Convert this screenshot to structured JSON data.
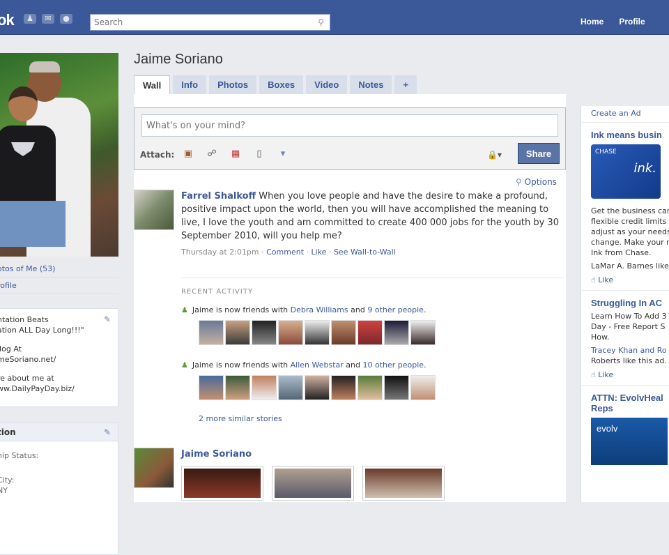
{
  "topbar": {
    "logo": "ok",
    "search_placeholder": "Search",
    "nav": [
      "Home",
      "Profile"
    ]
  },
  "left": {
    "photos_link": "otos of Me (53)",
    "profile_link": "rofile",
    "bio": [
      "ntation Beats\nation ALL Day Long!!!\"",
      "llog At\nmeSoriano.net/",
      "re about me at\nww.DailyPayDay.biz/"
    ],
    "info": {
      "header": "tion",
      "rows": [
        "hip Status:",
        "City:",
        "NY"
      ]
    }
  },
  "profile": {
    "name": "Jaime Soriano",
    "tabs": [
      "Wall",
      "Info",
      "Photos",
      "Boxes",
      "Video",
      "Notes",
      "+"
    ]
  },
  "composer": {
    "placeholder": "What's on your mind?",
    "attach_label": "Attach:",
    "share_label": "Share"
  },
  "options_label": "Options",
  "story1": {
    "actor": "Farrel Shalkoff",
    "text": " When you love people and have the desire to make a profound, positive impact upon the world, then you will have accomplished the meaning to live, I love the youth and am committed to create 400 000 jobs for the youth by 30 September 2010, will you help me?",
    "time": "Thursday at 2:01pm",
    "comment": "Comment",
    "like": "Like",
    "wall": "See Wall-to-Wall"
  },
  "recent": {
    "header": "RECENT ACTIVITY",
    "line1": {
      "prefix": "Jaime is now friends with ",
      "friend": "Debra Williams",
      "and": " and ",
      "others": "9 other people",
      "end": "."
    },
    "line2": {
      "prefix": "Jaime is now friends with ",
      "friend": "Allen Webstar",
      "and": " and ",
      "others": "10 other people",
      "end": "."
    },
    "more": "2 more similar stories"
  },
  "story2": {
    "actor": "Jaime Soriano"
  },
  "right": {
    "create_ad": "Create an Ad",
    "ad1": {
      "title": "Ink means busin",
      "body": [
        "Get the business car",
        "flexible credit limits t",
        "adjust as your needs",
        "change. Make your n",
        "Ink from Chase."
      ],
      "liker": "LaMar A. Barnes like",
      "like": "Like",
      "card_brand": "CHASE",
      "card_mark": "ink."
    },
    "ad2": {
      "title": "Struggling In AC",
      "body": [
        "Learn How To Add 3",
        "Day - Free Report S",
        "How."
      ],
      "liker": [
        "Tracey Khan and Ro",
        "Roberts like this ad."
      ],
      "like": "Like"
    },
    "ad3": {
      "title": "ATTN: EvolvHeal",
      "title2": "Reps",
      "brand": "evolv"
    }
  },
  "colors": {
    "brand": "#3b5998",
    "tab_bg": "#d8dfea",
    "share_btn": "#5b74a8"
  }
}
